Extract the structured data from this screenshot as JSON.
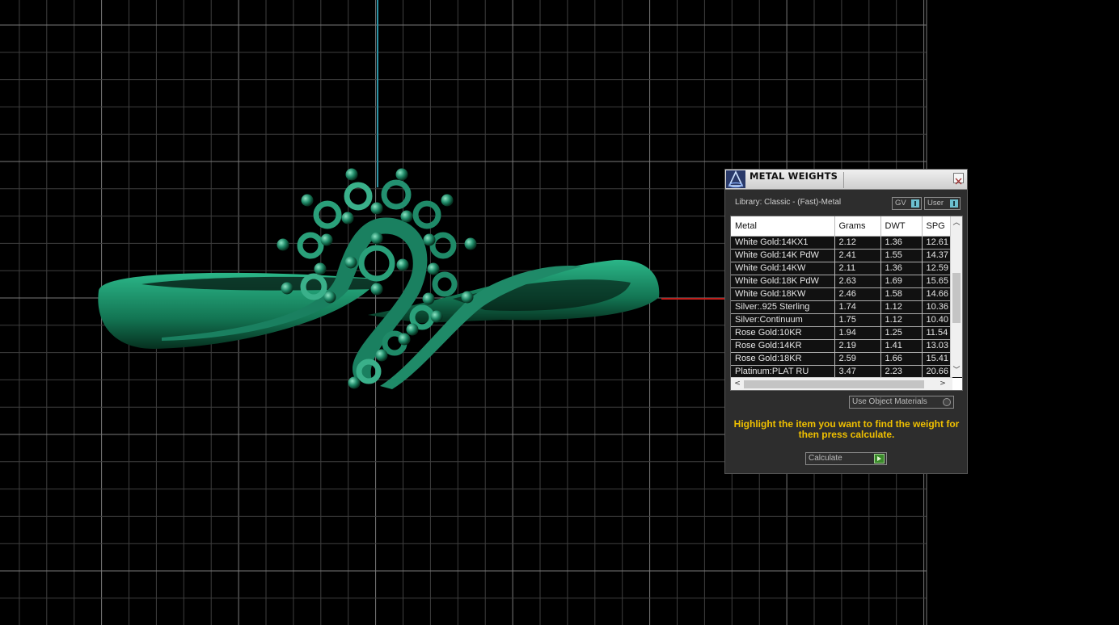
{
  "panel": {
    "title": "METAL WEIGHTS",
    "library_label": "Library: Classic - (Fast)-Metal",
    "toggle_gv": "GV",
    "toggle_user": "User",
    "table": {
      "columns": [
        "Metal",
        "Grams",
        "DWT",
        "SPG"
      ],
      "rows": [
        [
          "White Gold:14KX1",
          "2.12",
          "1.36",
          "12.61"
        ],
        [
          "White Gold:14K PdW",
          "2.41",
          "1.55",
          "14.37"
        ],
        [
          "White Gold:14KW",
          "2.11",
          "1.36",
          "12.59"
        ],
        [
          "White Gold:18K PdW",
          "2.63",
          "1.69",
          "15.65"
        ],
        [
          "White Gold:18KW",
          "2.46",
          "1.58",
          "14.66"
        ],
        [
          "Silver:.925 Sterling",
          "1.74",
          "1.12",
          "10.36"
        ],
        [
          "Silver:Continuum",
          "1.75",
          "1.12",
          "10.40"
        ],
        [
          "Rose Gold:10KR",
          "1.94",
          "1.25",
          "11.54"
        ],
        [
          "Rose Gold:14KR",
          "2.19",
          "1.41",
          "13.03"
        ],
        [
          "Rose Gold:18KR",
          "2.59",
          "1.66",
          "15.41"
        ],
        [
          "Platinum:PLAT RU",
          "3.47",
          "2.23",
          "20.66"
        ]
      ]
    },
    "use_object_materials": "Use Object Materials",
    "hint": "Highlight the item you want to find the weight for then press calculate.",
    "calculate": "Calculate"
  },
  "colors": {
    "grid": "#6b6b6b",
    "model": "#1f8a68",
    "y_axis": "#2c93a6",
    "x_axis": "#c0201c",
    "hint_text": "#f0c000"
  }
}
